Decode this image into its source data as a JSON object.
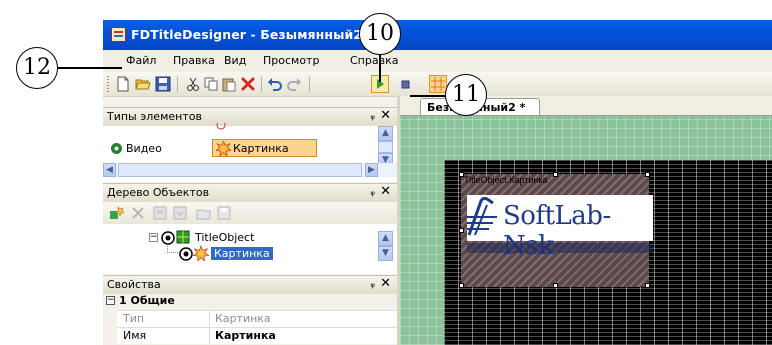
{
  "window": {
    "title": "FDTitleDesigner - Безымянный2",
    "app_icon": "fdtitledesigner-app-icon"
  },
  "menu": {
    "items": [
      "Файл",
      "Правка",
      "Вид",
      "Просмотр",
      "Справка"
    ]
  },
  "toolbar": {
    "buttons": [
      "new-file-icon",
      "open-folder-icon",
      "save-icon",
      "cut-icon",
      "copy-icon",
      "paste-icon",
      "delete-icon",
      "undo-icon",
      "redo-icon",
      "play-preview-icon",
      "stop-icon",
      "grid-icon"
    ]
  },
  "panels": {
    "element_types": {
      "title": "Типы элементов",
      "items": [
        "Видео",
        "Картинка"
      ]
    },
    "object_tree": {
      "title": "Дерево Объектов",
      "nodes": [
        "TitleObject",
        "Картинка"
      ]
    },
    "properties": {
      "title": "Свойства",
      "group": "1 Общие",
      "rows": [
        {
          "name": "Тип",
          "value": "Картинка"
        },
        {
          "name": "Имя",
          "value": "Картинка"
        }
      ]
    },
    "pin_glyph": "ᵩ",
    "close_glyph": "✕"
  },
  "document": {
    "tab_label": "Безымянный2 *",
    "object_label": "TitleObject.Картинка",
    "logo_text": "SoftLab-Nsk"
  },
  "callouts": {
    "c10": "10",
    "c11": "11",
    "c12": "12"
  },
  "colors": {
    "titlebar": "#0a5ee6",
    "stage_green": "#8cc29a",
    "selection": "#316ac5",
    "logo_blue": "#1d3a8f"
  }
}
